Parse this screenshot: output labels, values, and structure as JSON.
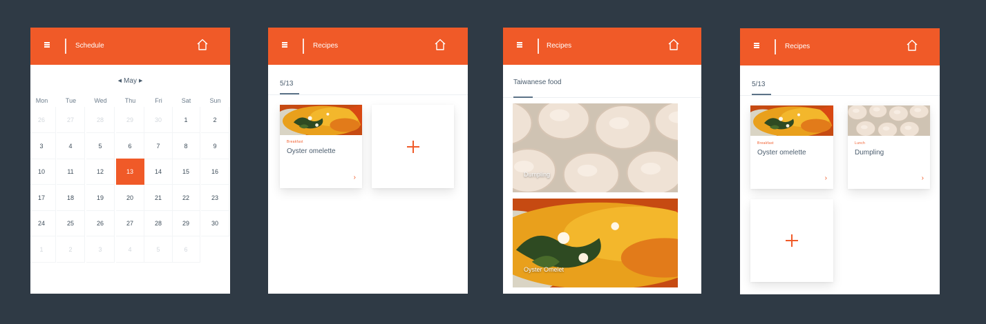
{
  "screen1": {
    "title": "Schedule",
    "month": "May",
    "weekdays": [
      "Mon",
      "Tue",
      "Wed",
      "Thu",
      "Fri",
      "Sat",
      "Sun"
    ],
    "weeks": [
      [
        "26",
        "27",
        "28",
        "29",
        "30",
        "1",
        "2"
      ],
      [
        "3",
        "4",
        "5",
        "6",
        "7",
        "8",
        "9"
      ],
      [
        "10",
        "11",
        "12",
        "13",
        "14",
        "15",
        "16"
      ],
      [
        "17",
        "18",
        "19",
        "20",
        "21",
        "22",
        "23"
      ],
      [
        "24",
        "25",
        "26",
        "27",
        "28",
        "29",
        "30"
      ],
      [
        "1",
        "2",
        "3",
        "4",
        "5",
        "6"
      ]
    ],
    "selected_day": "13"
  },
  "screen2": {
    "title": "Recipes",
    "tab": "5/13",
    "cards": [
      {
        "meal": "Breakfast",
        "name": "Oyster omelette",
        "arrow": "›"
      }
    ]
  },
  "screen3": {
    "title": "Recipes",
    "tab": "Taiwanese food",
    "photos": [
      {
        "caption": "Dumpling"
      },
      {
        "caption": "Oyster Omelet"
      }
    ]
  },
  "screen4": {
    "title": "Recipes",
    "tab": "5/13",
    "cards": [
      {
        "meal": "Breakfast",
        "name": "Oyster omelette",
        "arrow": "›"
      },
      {
        "meal": "Lunch",
        "name": "Dumpling",
        "arrow": "›"
      }
    ]
  },
  "colors": {
    "background": "#2f3a45",
    "accent": "#f05a28",
    "text": "#4b5d6e"
  },
  "icons": [
    "menu-icon",
    "home-icon",
    "chevron-left-icon",
    "chevron-right-icon",
    "plus-icon"
  ]
}
